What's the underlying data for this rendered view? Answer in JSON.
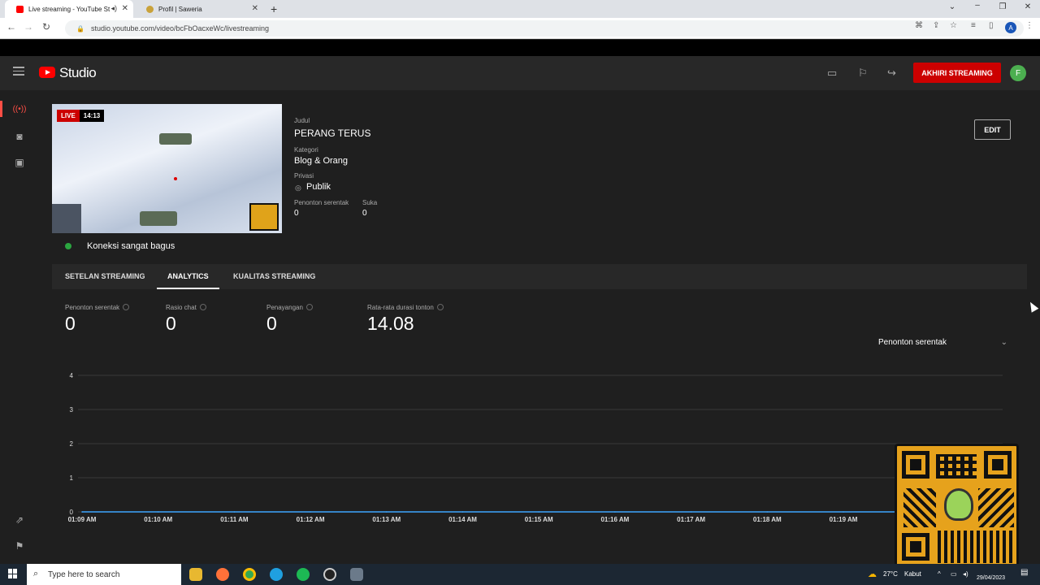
{
  "browser": {
    "tabs": [
      {
        "title": "Live streaming - YouTube St",
        "active": true,
        "favicon_color": "#ff0000"
      },
      {
        "title": "Profil | Saweria",
        "active": false,
        "favicon_color": "#c9a23a"
      }
    ],
    "url": "studio.youtube.com/video/bcFbOacxeWc/livestreaming",
    "profile_initial": "A"
  },
  "studio": {
    "logo_text": "Studio",
    "end_stream_label": "AKHIRI STREAMING",
    "avatar_initial": "F"
  },
  "stream": {
    "live_label": "LIVE",
    "live_time": "14:13",
    "title_label": "Judul",
    "title": "PERANG TERUS",
    "category_label": "Kategori",
    "category": "Blog & Orang",
    "privacy_label": "Privasi",
    "privacy": "Publik",
    "concurrent_label": "Penonton serentak",
    "concurrent": "0",
    "likes_label": "Suka",
    "likes": "0",
    "edit_label": "EDIT",
    "connection": "Koneksi sangat bagus"
  },
  "tabs": [
    {
      "label": "SETELAN STREAMING"
    },
    {
      "label": "ANALYTICS",
      "active": true
    },
    {
      "label": "KUALITAS STREAMING"
    }
  ],
  "metrics": [
    {
      "label": "Penonton serentak",
      "value": "0"
    },
    {
      "label": "Rasio chat",
      "value": "0"
    },
    {
      "label": "Penayangan",
      "value": "0"
    },
    {
      "label": "Rata-rata durasi tonton",
      "value": "14.08"
    }
  ],
  "dropdown": {
    "selected": "Penonton serentak"
  },
  "chart_data": {
    "type": "line",
    "title": "",
    "xlabel": "",
    "ylabel": "",
    "ylim": [
      0,
      4
    ],
    "y_ticks": [
      "0",
      "1",
      "2",
      "3",
      "4"
    ],
    "categories": [
      "01:09 AM",
      "01:10 AM",
      "01:11 AM",
      "01:12 AM",
      "01:13 AM",
      "01:14 AM",
      "01:15 AM",
      "01:16 AM",
      "01:17 AM",
      "01:18 AM",
      "01:19 AM"
    ],
    "series": [
      {
        "values": [
          0,
          0,
          0,
          0,
          0,
          0,
          0,
          0,
          0,
          0,
          0
        ],
        "color": "#3ea6ff"
      }
    ],
    "grid": true
  },
  "taskbar": {
    "search_placeholder": "Type here to search",
    "weather": "27°C",
    "weather_desc": "Kabut",
    "date": "29/04/2023"
  },
  "colors": {
    "accent": "#cc0000",
    "status_ok": "#2ba640",
    "line": "#3ea6ff"
  }
}
